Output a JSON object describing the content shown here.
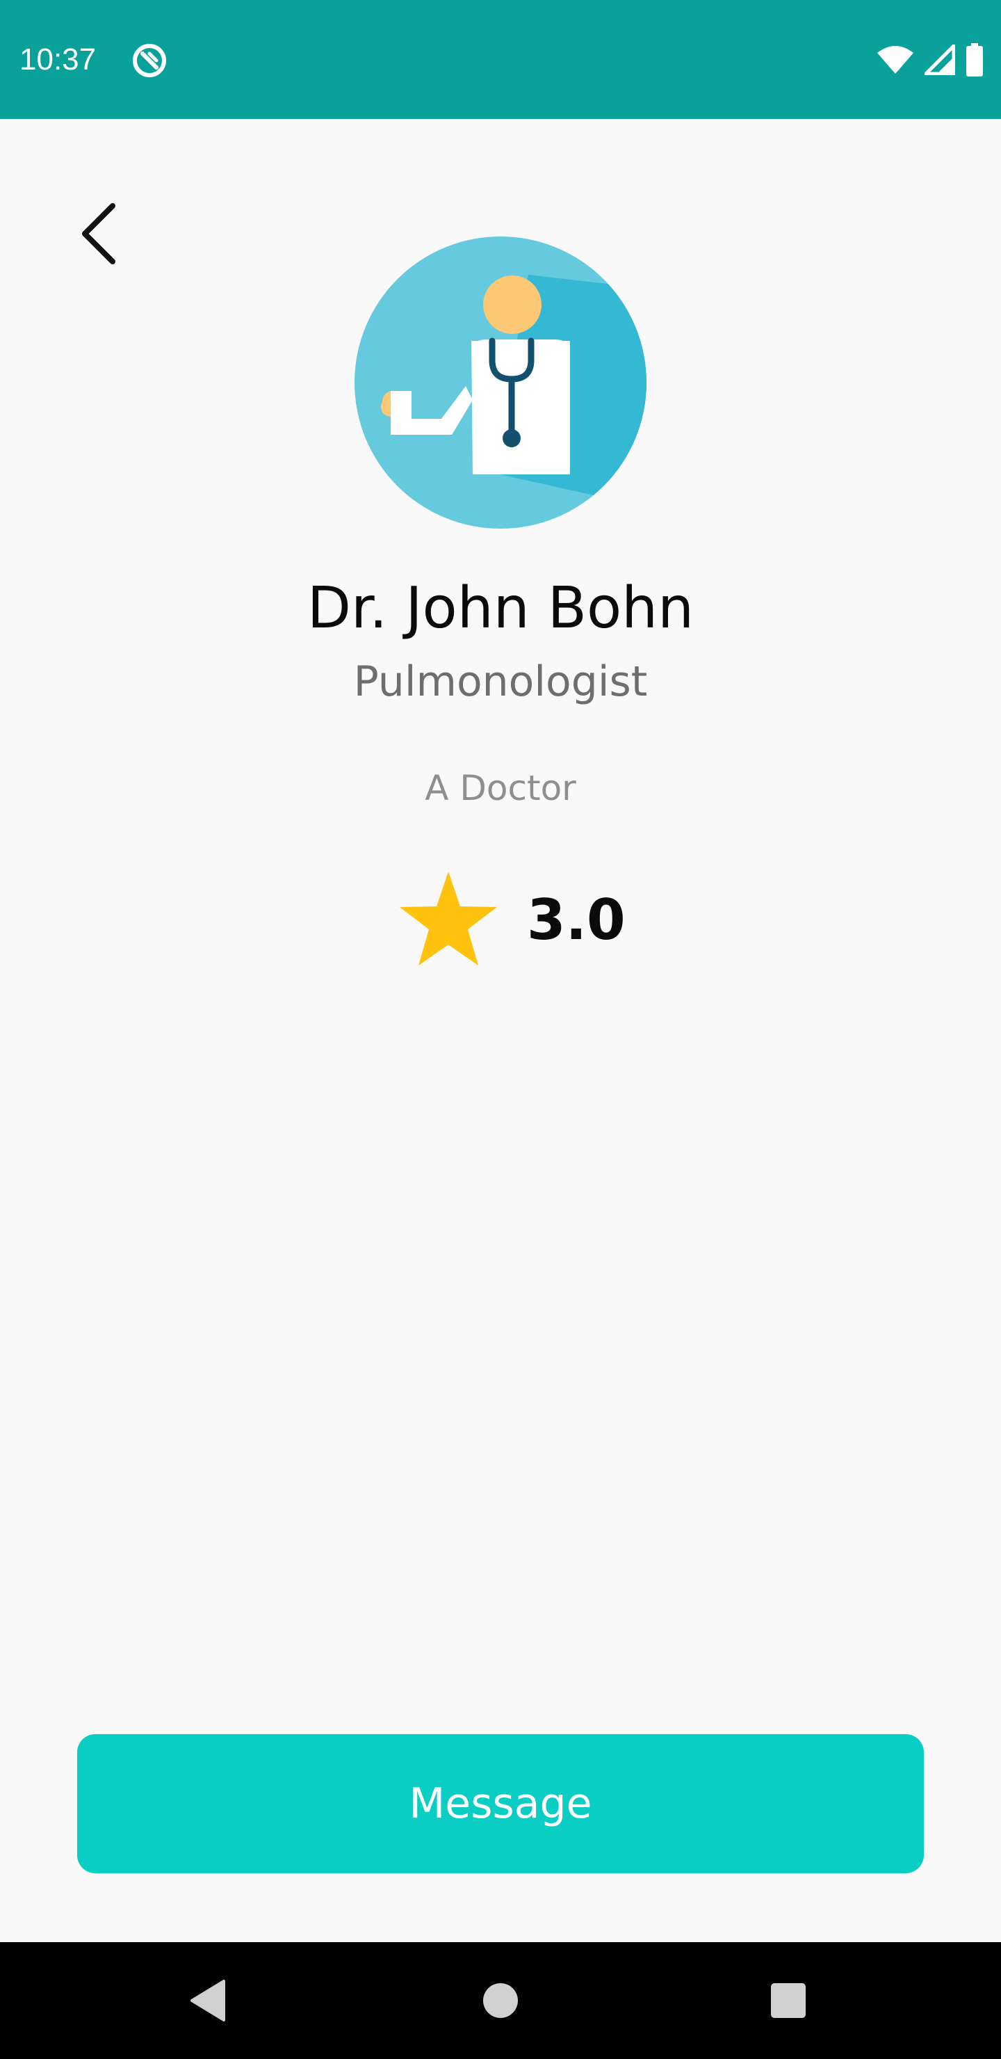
{
  "status_bar": {
    "time": "10:37",
    "background_color": "#0aa19a",
    "icons": [
      "app-notification-icon",
      "wifi-icon",
      "signal-icon",
      "battery-icon"
    ]
  },
  "header": {
    "back_icon": "back-arrow-icon"
  },
  "profile": {
    "avatar_icon": "doctor-avatar-icon",
    "name": "Dr. John Bohn",
    "specialty": "Pulmonologist",
    "description": "A Doctor",
    "rating": "3.0",
    "rating_icon": "star-icon",
    "star_color": "#fec20f"
  },
  "actions": {
    "message_label": "Message",
    "button_color": "#0acdc4"
  },
  "nav_bar": {
    "icons": [
      "nav-back-icon",
      "nav-home-icon",
      "nav-recents-icon"
    ]
  }
}
